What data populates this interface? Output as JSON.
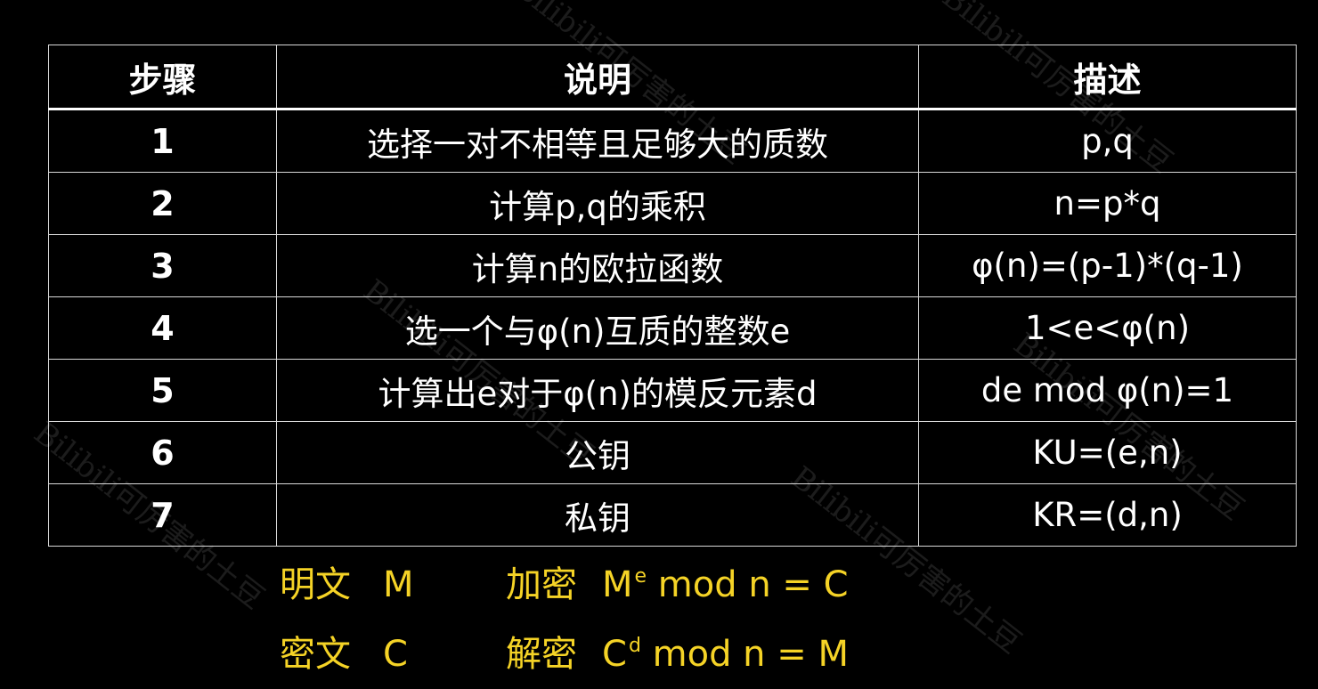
{
  "table": {
    "headers": [
      "步骤",
      "说明",
      "描述"
    ],
    "rows": [
      {
        "step": "1",
        "explanation": "选择一对不相等且足够大的质数",
        "description": "p,q"
      },
      {
        "step": "2",
        "explanation": "计算p,q的乘积",
        "description": "n=p*q"
      },
      {
        "step": "3",
        "explanation": "计算n的欧拉函数",
        "description": "φ(n)=(p-1)*(q-1)"
      },
      {
        "step": "4",
        "explanation": "选一个与φ(n)互质的整数e",
        "description": "1<e<φ(n)"
      },
      {
        "step": "5",
        "explanation": "计算出e对于φ(n)的模反元素d",
        "description": "de mod φ(n)=1"
      },
      {
        "step": "6",
        "explanation": "公钥",
        "description": "KU=(e,n)"
      },
      {
        "step": "7",
        "explanation": "私钥",
        "description": "KR=(d,n)"
      }
    ]
  },
  "formulas": {
    "plaintext_label": "明文",
    "plaintext_var": "M",
    "encrypt_label": "加密",
    "encrypt_base": "M",
    "encrypt_exp": "e",
    "encrypt_rest": "mod n = C",
    "ciphertext_label": "密文",
    "ciphertext_var": "C",
    "decrypt_label": "解密",
    "decrypt_base": "C",
    "decrypt_exp": "d",
    "decrypt_rest": "mod n = M"
  },
  "watermark": "Bilibili可厉害的土豆",
  "colors": {
    "background": "#000000",
    "text": "#ffffff",
    "formula": "#f5d326",
    "border": "#d9d9d9"
  }
}
